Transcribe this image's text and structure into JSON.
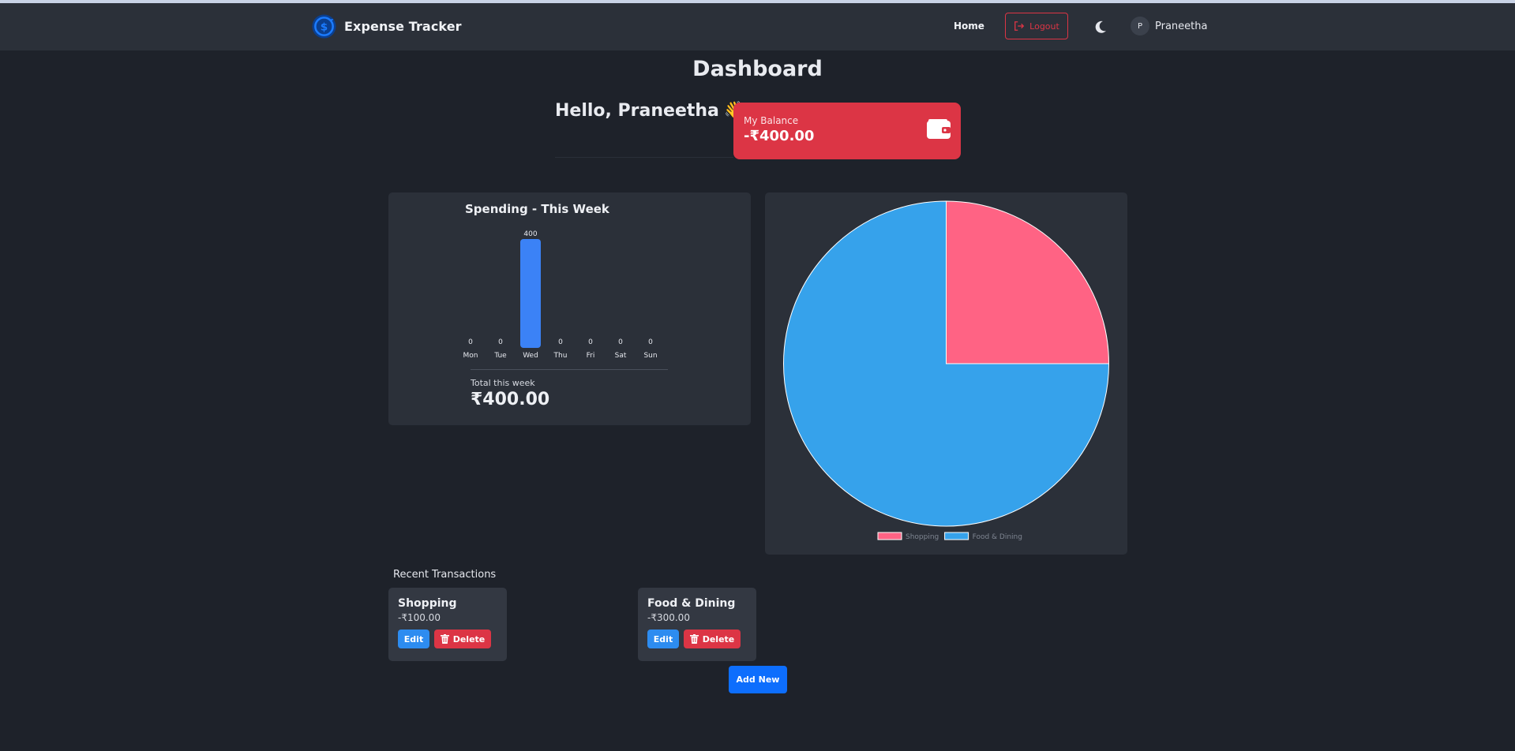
{
  "navbar": {
    "brand": "Expense Tracker",
    "home": "Home",
    "logout": "Logout",
    "avatar_initial": "P",
    "user_name": "Praneetha"
  },
  "page": {
    "title": "Dashboard",
    "greeting": "Hello, Praneetha",
    "greeting_emoji": "👋"
  },
  "balance": {
    "label": "My Balance",
    "value": "-₹400.00"
  },
  "colors": {
    "accent_red": "#dc3545",
    "bar_blue": "#3b82f6",
    "pie_shopping": "#ff6384",
    "pie_food": "#36a2eb"
  },
  "chart_data": [
    {
      "type": "bar",
      "title": "Spending - This Week",
      "categories": [
        "Mon",
        "Tue",
        "Wed",
        "Thu",
        "Fri",
        "Sat",
        "Sun"
      ],
      "values": [
        0,
        0,
        400,
        0,
        0,
        0,
        0
      ],
      "data_labels": true,
      "grid": false
    },
    {
      "type": "pie",
      "categories": [
        "Shopping",
        "Food & Dining"
      ],
      "values": [
        100,
        300
      ],
      "legend": "bottom"
    }
  ],
  "weekly_total": {
    "label": "Total this week",
    "value": "₹400.00"
  },
  "recent": {
    "title": "Recent Transactions",
    "items": [
      {
        "name": "Shopping",
        "amount": "-₹100.00",
        "edit": "Edit",
        "delete": "Delete"
      },
      {
        "name": "Food & Dining",
        "amount": "-₹300.00",
        "edit": "Edit",
        "delete": "Delete"
      }
    ],
    "add_new": "Add New"
  }
}
